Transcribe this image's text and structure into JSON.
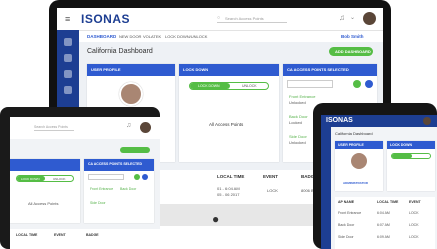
{
  "brand": "ISONAS",
  "monitor": {
    "search_placeholder": "Search Access Points",
    "user_menu": "Bob Smith",
    "tabs": [
      "DASHBOARD",
      "NEW DOOR",
      "VOLATEK",
      "LOCK DOWN/UNLOCK"
    ],
    "page_title": "California Dashboard",
    "new_button": "ADD DASHBOARD",
    "card_user_profile": "USER PROFILE",
    "card_lock_down": "LOCK DOWN",
    "card_access_points": "CA ACCESS POINTS SELECTED",
    "lock_btn_active": "LOCK DOWN",
    "lock_btn_inactive": "UNLOCK",
    "all_access_points": "All Access Points",
    "ap_1": "Front Entrance",
    "ap_1_sub": "Unlocked",
    "ap_2": "Back Door",
    "ap_2_sub": "Locked",
    "ap_3": "Side Door",
    "ap_3_sub": "Unlocked",
    "profile_link": "ADMINISTRATOR",
    "table_headers": [
      "LOCAL TIME",
      "EVENT",
      "BADGE"
    ],
    "row_time": "01 - 6:04 AM",
    "row_time2": "05 - 06 2017",
    "row_event": "LOCK",
    "row_badge": "8006 BLK"
  },
  "tablet": {
    "search_placeholder": "Search Access Points",
    "card_access_points": "CA ACCESS POINTS SELECTED",
    "lock_btn_active": "LOCK DOWN",
    "lock_btn_inactive": "UNLOCK",
    "all_access_points": "All Access Points",
    "ap_1": "Front Entrance",
    "ap_2": "Back Door",
    "ap_3": "Side Door",
    "headers": [
      "LOCAL TIME",
      "EVENT",
      "BADGE"
    ]
  },
  "phone": {
    "brand": "ISONAS",
    "page_title": "California Dashboard",
    "card_user": "USER PROFILE",
    "card_lock": "LOCK DOWN",
    "profile_link": "ADMINISTRATOR",
    "headers": [
      "AP NAME",
      "LOCAL TIME",
      "EVENT"
    ],
    "rows": [
      {
        "name": "Front Entrance",
        "time": "6:04 AM",
        "event": "LOCK"
      },
      {
        "name": "Back Door",
        "time": "6:07 AM",
        "event": "LOCK"
      },
      {
        "name": "Side Door",
        "time": "6:09 AM",
        "event": "LOCK"
      }
    ]
  },
  "colors": {
    "brand_blue": "#1d3e92",
    "header_blue": "#2f5bd0",
    "accent_green": "#55bd45"
  }
}
